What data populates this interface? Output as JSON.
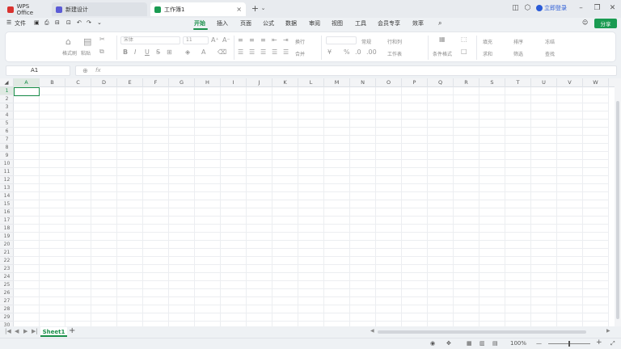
{
  "titlebar": {
    "tabs": [
      {
        "label": "WPS Office",
        "icon": "wps-logo-icon",
        "color": "#d9322f"
      },
      {
        "label": "新建设计",
        "icon": "design-icon",
        "color": "#5b5bd6"
      },
      {
        "label": "工作簿1",
        "icon": "spreadsheet-icon",
        "color": "#1a9b52",
        "active": true
      }
    ],
    "new_tab_symbol": "+",
    "login_label": "立即登录"
  },
  "menubar": {
    "file_label": "文件",
    "items": [
      "开始",
      "插入",
      "页面",
      "公式",
      "数据",
      "审阅",
      "视图",
      "工具",
      "会员专享",
      "效率"
    ],
    "active": "开始",
    "share_label": "分享"
  },
  "ribbon": {
    "format_painter": "格式刷",
    "paste": "粘贴",
    "font_name": "宋体",
    "font_size": "11",
    "wrap": "换行",
    "merge": "合并",
    "number_format": "常规",
    "rows_cols": "行和列",
    "worksheet": "工作表",
    "conditional_format": "条件格式",
    "fill": "填充",
    "sort": "排序",
    "freeze": "冻结",
    "sum": "求和",
    "filter": "筛选",
    "find": "查找"
  },
  "formulabar": {
    "cell_ref": "A1",
    "fx_symbol": "fx",
    "formula": ""
  },
  "grid": {
    "columns": [
      "A",
      "B",
      "C",
      "D",
      "E",
      "F",
      "G",
      "H",
      "I",
      "J",
      "K",
      "L",
      "M",
      "N",
      "O",
      "P",
      "Q",
      "R",
      "S",
      "T",
      "U",
      "V",
      "W"
    ],
    "rows": [
      "1",
      "2",
      "3",
      "4",
      "5",
      "6",
      "7",
      "8",
      "9",
      "10",
      "11",
      "12",
      "13",
      "14",
      "15",
      "16",
      "17",
      "18",
      "19",
      "20",
      "21",
      "22",
      "23",
      "24",
      "25",
      "26",
      "27",
      "28",
      "29",
      "30"
    ],
    "selected": "A1"
  },
  "sheets": {
    "tabs": [
      "Sheet1"
    ],
    "add_symbol": "+"
  },
  "statusbar": {
    "zoom": "100%",
    "zoom_minus": "—",
    "zoom_plus": "+"
  },
  "colors": {
    "accent": "#1a8f4a",
    "share_bg": "#1a9b52",
    "login": "#2a5bd7"
  }
}
